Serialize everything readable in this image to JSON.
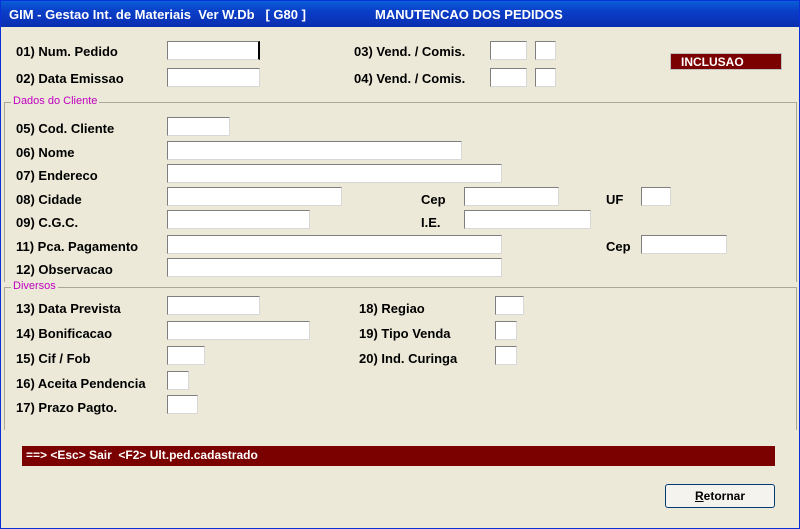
{
  "window": {
    "title_left": "GIM - Gestao Int. de Materiais  Ver W.Db   [ G80 ]",
    "title_right": "MANUTENCAO DOS PEDIDOS",
    "mode_badge": "INCLUSAO"
  },
  "header_fields": {
    "num_pedido": "01)  Num. Pedido",
    "data_emissao": "02)  Data Emissao",
    "vend_comis_3": "03)  Vend. / Comis.",
    "vend_comis_4": "04)  Vend. / Comis."
  },
  "groups": {
    "cliente": "Dados do Cliente",
    "diversos": "Diversos"
  },
  "cliente_fields": {
    "cod_cliente": "05)  Cod. Cliente",
    "nome": "06)  Nome",
    "endereco": "07)  Endereco",
    "cidade": "08)  Cidade",
    "cgc": "09)  C.G.C.",
    "pca_pagamento": "11)  Pca. Pagamento",
    "observacao": "12)  Observacao",
    "cep": "Cep",
    "uf": "UF",
    "ie": "I.E.",
    "cep2": "Cep"
  },
  "diversos_fields": {
    "data_prevista": "13)  Data Prevista",
    "bonificacao": "14)  Bonificacao",
    "cif_fob": "15)  Cif / Fob",
    "aceita_pendencia": "16)  Aceita Pendencia",
    "prazo_pagto": "17)  Prazo Pagto.",
    "regiao": "18)  Regiao",
    "tipo_venda": "19)  Tipo Venda",
    "ind_curinga": "20)  Ind. Curinga"
  },
  "status_bar": "==> <Esc> Sair  <F2> Ult.ped.cadastrado",
  "buttons": {
    "retornar_prefix": "R",
    "retornar_rest": "etornar"
  }
}
